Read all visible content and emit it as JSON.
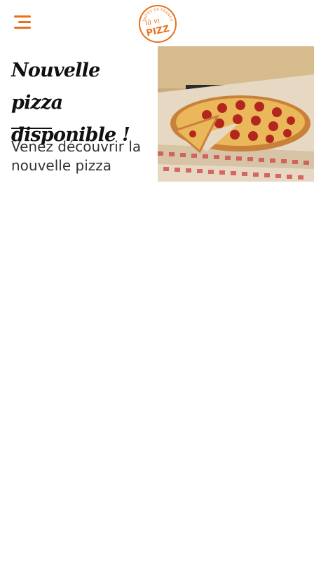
{
  "header": {
    "menu_icon": "hamburger-menu-icon",
    "logo": {
      "brand_text": "PIZZ",
      "script_text": "là vi",
      "arc_text": "FAITES DE FRANCE",
      "accent_color": "#e8711e"
    }
  },
  "card": {
    "title": "Nouvelle pizza disponible !",
    "description": "Venez découvrir la nouvelle pizza",
    "image_icon": "pepperoni-pizza-photo"
  },
  "colors": {
    "accent": "#e8711e",
    "background": "#ffffff",
    "text": "#111111"
  }
}
